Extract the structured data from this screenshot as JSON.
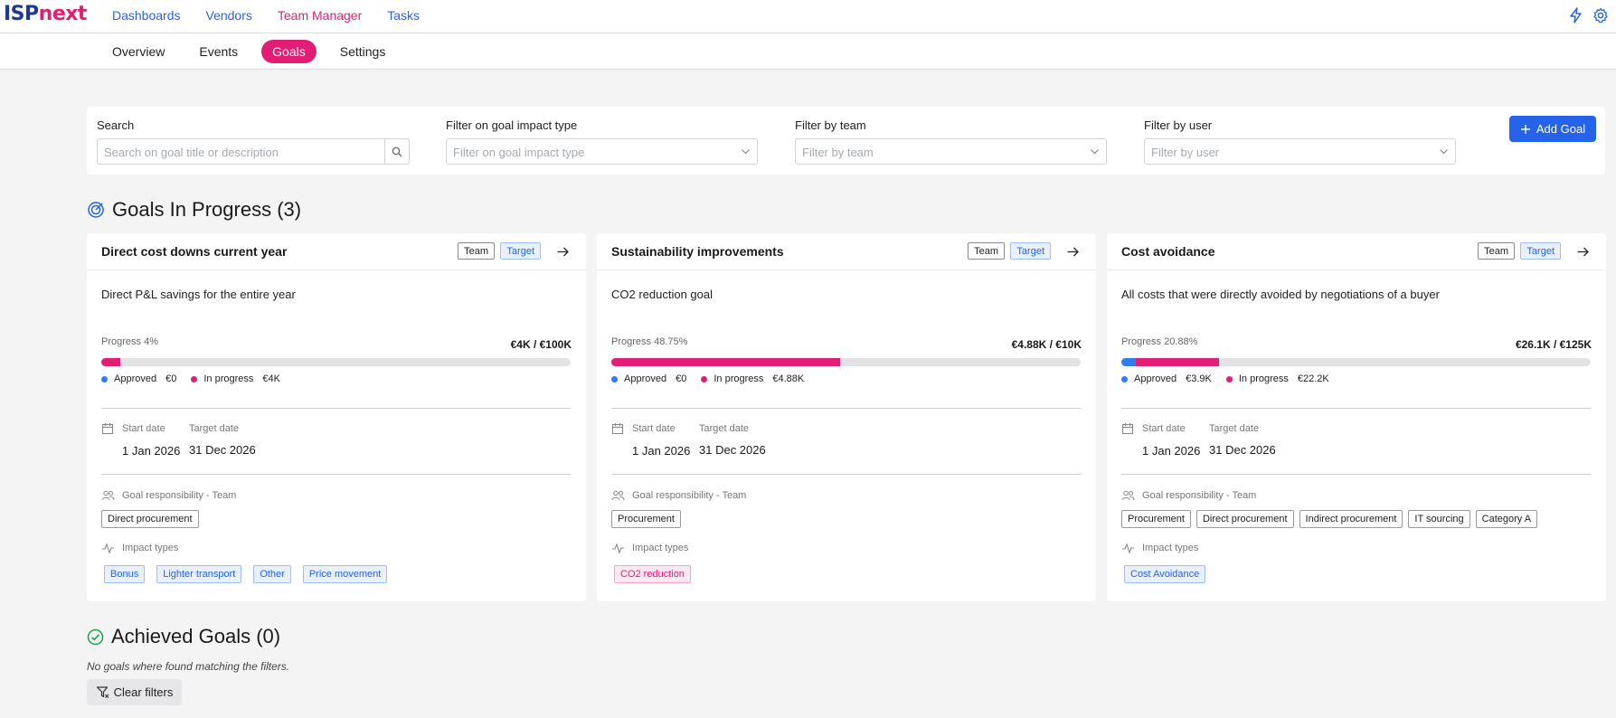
{
  "app": {
    "logo_part1": "ISP",
    "logo_part2": "next",
    "nav": [
      "Dashboards",
      "Vendors",
      "Team Manager",
      "Tasks"
    ],
    "active_nav": "Team Manager",
    "icons": [
      "lightning-icon",
      "gear-icon"
    ]
  },
  "subnav": {
    "tabs": [
      "Overview",
      "Events",
      "Goals",
      "Settings"
    ],
    "active_tab": "Goals"
  },
  "filters": {
    "search_label": "Search",
    "search_placeholder": "Search on goal title or description",
    "impact_label": "Filter on goal impact type",
    "impact_placeholder": "Filter on goal impact type",
    "team_label": "Filter by team",
    "team_placeholder": "Filter by team",
    "user_label": "Filter by user",
    "user_placeholder": "Filter by user",
    "add_goal": "Add Goal"
  },
  "in_progress": {
    "heading": "Goals In Progress (3)",
    "cards": [
      {
        "title": "Direct cost downs current year",
        "tag_team": "Team",
        "tag_target": "Target",
        "description": "Direct P&L savings for the entire year",
        "progress_label": "Progress 4%",
        "amount": "€4K / €100K",
        "approved_fraction": 0,
        "inprogress_fraction": 0.04,
        "approved_label": "Approved",
        "approved_value": "€0",
        "inprogress_label": "In progress",
        "inprogress_value": "€4K",
        "start_label": "Start date",
        "start_date": "1 Jan 2026",
        "target_label": "Target date",
        "target_date": "31 Dec 2026",
        "resp_label": "Goal responsibility - Team",
        "teams": [
          "Direct procurement"
        ],
        "impact_label": "Impact types",
        "impacts": [
          "Bonus",
          "Lighter transport",
          "Other",
          "Price movement"
        ],
        "impact_color": "blue"
      },
      {
        "title": "Sustainability improvements",
        "tag_team": "Team",
        "tag_target": "Target",
        "description": "CO2 reduction goal",
        "progress_label": "Progress 48.75%",
        "amount": "€4.88K / €10K",
        "approved_fraction": 0,
        "inprogress_fraction": 0.4875,
        "approved_label": "Approved",
        "approved_value": "€0",
        "inprogress_label": "In progress",
        "inprogress_value": "€4.88K",
        "start_label": "Start date",
        "start_date": "1 Jan 2026",
        "target_label": "Target date",
        "target_date": "31 Dec 2026",
        "resp_label": "Goal responsibility - Team",
        "teams": [
          "Procurement"
        ],
        "impact_label": "Impact types",
        "impacts": [
          "CO2 reduction"
        ],
        "impact_color": "pink"
      },
      {
        "title": "Cost avoidance",
        "tag_team": "Team",
        "tag_target": "Target",
        "description": "All costs that were directly avoided by negotiations of a buyer",
        "progress_label": "Progress 20.88%",
        "amount": "€26.1K / €125K",
        "approved_fraction": 0.0312,
        "inprogress_fraction": 0.1776,
        "approved_label": "Approved",
        "approved_value": "€3.9K",
        "inprogress_label": "In progress",
        "inprogress_value": "€22.2K",
        "start_label": "Start date",
        "start_date": "1 Jan 2026",
        "target_label": "Target date",
        "target_date": "31 Dec 2026",
        "resp_label": "Goal responsibility - Team",
        "teams": [
          "Procurement",
          "Direct procurement",
          "Indirect procurement",
          "IT sourcing",
          "Category A"
        ],
        "impact_label": "Impact types",
        "impacts": [
          "Cost Avoidance"
        ],
        "impact_color": "blue"
      }
    ]
  },
  "achieved": {
    "heading": "Achieved Goals (0)",
    "empty_text": "No goals where found matching the filters.",
    "clear_filters": "Clear filters"
  }
}
